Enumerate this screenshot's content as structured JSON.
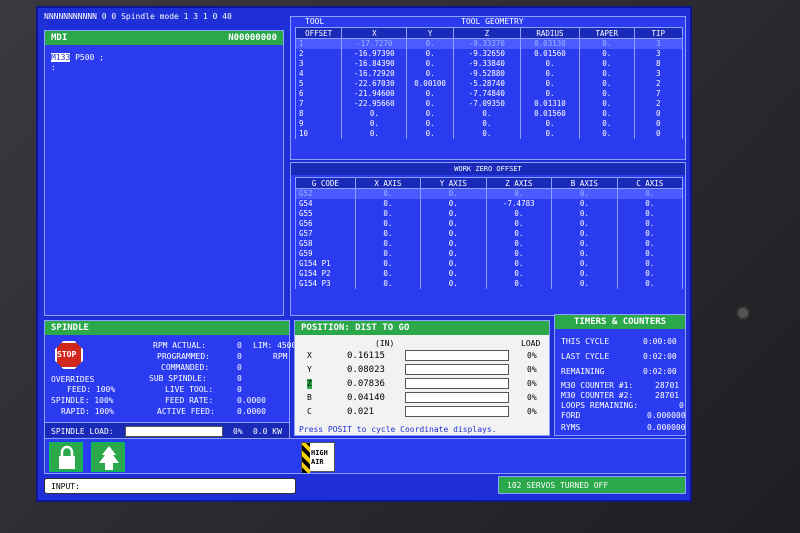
{
  "status_line": "NNNNNNNNNNN   0   0 Spindle mode 1  3   1   0   40",
  "mdi": {
    "title": "MDI",
    "program": "N00000000",
    "cursor": "M133",
    "line": " P500 ;",
    "line2": ":"
  },
  "tool": {
    "tab_left": "TOOL",
    "tab_right": "TOOL GEOMETRY",
    "headers": [
      "OFFSET",
      "X",
      "Y",
      "Z",
      "RADIUS",
      "TAPER",
      "TIP"
    ],
    "rows": [
      [
        "1",
        "-17.7270",
        "0.",
        "-9.33370",
        "0.03130",
        "0.",
        "3"
      ],
      [
        "2",
        "-16.97390",
        "0.",
        "-9.32650",
        "0.01560",
        "0.",
        "3"
      ],
      [
        "3",
        "-16.84390",
        "0.",
        "-9.33840",
        "0.",
        "0.",
        "8"
      ],
      [
        "4",
        "-16.72920",
        "0.",
        "-9.52880",
        "0.",
        "0.",
        "3"
      ],
      [
        "5",
        "-22.67030",
        "0.00100",
        "-5.28740",
        "0.",
        "0.",
        "2"
      ],
      [
        "6",
        "-21.94600",
        "0.",
        "-7.74840",
        "0.",
        "0.",
        "7"
      ],
      [
        "7",
        "-22.95660",
        "0.",
        "-7.09350",
        "0.01310",
        "0.",
        "2"
      ],
      [
        "8",
        "0.",
        "0.",
        "0.",
        "0.01560",
        "0.",
        "0"
      ],
      [
        "9",
        "0.",
        "0.",
        "0.",
        "0.",
        "0.",
        "0"
      ],
      [
        "10",
        "0.",
        "0.",
        "0.",
        "0.",
        "0.",
        "0"
      ]
    ]
  },
  "work": {
    "title": "WORK ZERO OFFSET",
    "headers": [
      "G CODE",
      "X AXIS",
      "Y AXIS",
      "Z AXIS",
      "B AXIS",
      "C AXIS"
    ],
    "rows": [
      [
        "G52",
        "0.",
        "0.",
        "0.",
        "0.",
        "0."
      ],
      [
        "G54",
        "0.",
        "0.",
        "-7.4783",
        "0.",
        "0."
      ],
      [
        "G55",
        "0.",
        "0.",
        "0.",
        "0.",
        "0."
      ],
      [
        "G56",
        "0.",
        "0.",
        "0.",
        "0.",
        "0."
      ],
      [
        "G57",
        "0.",
        "0.",
        "0.",
        "0.",
        "0."
      ],
      [
        "G58",
        "0.",
        "0.",
        "0.",
        "0.",
        "0."
      ],
      [
        "G59",
        "0.",
        "0.",
        "0.",
        "0.",
        "0."
      ],
      [
        "G154 P1",
        "0.",
        "0.",
        "0.",
        "0.",
        "0."
      ],
      [
        "G154 P2",
        "0.",
        "0.",
        "0.",
        "0.",
        "0."
      ],
      [
        "G154 P3",
        "0.",
        "0.",
        "0.",
        "0.",
        "0."
      ]
    ]
  },
  "spindle": {
    "title": "SPINDLE",
    "stop": "STOP",
    "overrides": "OVERRIDES",
    "feed": "FEED: 100%",
    "spindle": "SPINDLE: 100%",
    "rapid": "RAPID: 100%",
    "rpm_actual_l": "RPM ACTUAL:",
    "rpm_actual": "0",
    "lim": "LIM: 4500",
    "programmed_l": "PROGRAMMED:",
    "programmed": "0",
    "rpm": "RPM",
    "commanded_l": "COMMANDED:",
    "commanded": "0",
    "sub_l": "SUB SPINDLE:",
    "sub": "0",
    "live_l": "LIVE TOOL:",
    "live": "0",
    "fr_l": "FEED RATE:",
    "fr": "0.0000",
    "af_l": "ACTIVE FEED:",
    "af": "0.0000",
    "load_l": "SPINDLE LOAD:",
    "load_pct": "0%",
    "load_kw": "0.0 KW"
  },
  "position": {
    "title": "POSITION: DIST TO GO",
    "unit": "(IN)",
    "load": "LOAD",
    "axes": [
      {
        "axis": "X",
        "value": "0.16115",
        "load": "0%"
      },
      {
        "axis": "Y",
        "value": "0.08023",
        "load": "0%"
      },
      {
        "axis": "Z",
        "value": "0.07836",
        "load": "0%"
      },
      {
        "axis": "B",
        "value": "0.04140",
        "load": "0%"
      },
      {
        "axis": "C",
        "value": "0.021",
        "load": "0%"
      }
    ],
    "hint": "Press POSIT to cycle Coordinate displays."
  },
  "timers": {
    "title": "TIMERS & COUNTERS",
    "this_cycle_l": "THIS CYCLE",
    "this_cycle": "0:00:00",
    "last_cycle_l": "LAST CYCLE",
    "last_cycle": "0:02:00",
    "remaining_l": "REMAINING",
    "remaining": "0:02:00",
    "m30_1_l": "M30 COUNTER #1:",
    "m30_1": "28701",
    "m30_2_l": "M30 COUNTER #2:",
    "m30_2": "28701",
    "loops_l": "LOOPS REMAINING:",
    "loops": "0",
    "ford_l": "FORD",
    "ford": "0.000000",
    "ryms_l": "RYMS",
    "ryms": "0.000000"
  },
  "bottom": {
    "high_air": "HIGH AIR",
    "input_l": "INPUT:",
    "status": "102 SERVOS TURNED OFF"
  }
}
